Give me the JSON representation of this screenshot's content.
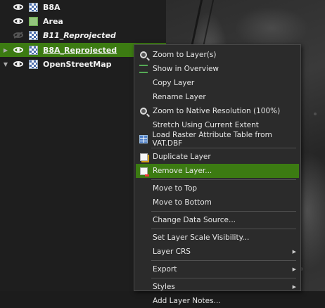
{
  "layers": [
    {
      "name": "B8A",
      "expanded": null,
      "visible": true,
      "type": "raster",
      "italic": false,
      "selected": false
    },
    {
      "name": "Area",
      "expanded": null,
      "visible": true,
      "type": "polygon",
      "italic": false,
      "selected": false
    },
    {
      "name": "B11_Reprojected",
      "expanded": null,
      "visible": false,
      "type": "raster",
      "italic": true,
      "selected": false
    },
    {
      "name": "B8A_Reprojected",
      "expanded": false,
      "visible": true,
      "type": "raster",
      "italic": false,
      "selected": true
    },
    {
      "name": "OpenStreetMap",
      "expanded": true,
      "visible": true,
      "type": "raster",
      "italic": false,
      "selected": false
    }
  ],
  "context_menu": {
    "items": [
      {
        "label": "Zoom to Layer(s)",
        "icon": "zoom-to-layer-icon",
        "has_submenu": false,
        "highlighted": false
      },
      {
        "label": "Show in Overview",
        "icon": "overview-icon",
        "has_submenu": false,
        "highlighted": false
      },
      {
        "label": "Copy Layer",
        "icon": null,
        "has_submenu": false,
        "highlighted": false
      },
      {
        "label": "Rename Layer",
        "icon": null,
        "has_submenu": false,
        "highlighted": false
      },
      {
        "label": "Zoom to Native Resolution (100%)",
        "icon": "zoom-native-icon",
        "has_submenu": false,
        "highlighted": false
      },
      {
        "label": "Stretch Using Current Extent",
        "icon": null,
        "has_submenu": false,
        "highlighted": false
      },
      {
        "label": "Load Raster Attribute Table from VAT.DBF",
        "icon": "table-icon",
        "has_submenu": false,
        "highlighted": false
      },
      {
        "separator": true
      },
      {
        "label": "Duplicate Layer",
        "icon": "duplicate-layer-icon",
        "has_submenu": false,
        "highlighted": false
      },
      {
        "label": "Remove Layer...",
        "icon": "remove-layer-icon",
        "has_submenu": false,
        "highlighted": true
      },
      {
        "separator": true
      },
      {
        "label": "Move to Top",
        "icon": null,
        "has_submenu": false,
        "highlighted": false
      },
      {
        "label": "Move to Bottom",
        "icon": null,
        "has_submenu": false,
        "highlighted": false
      },
      {
        "separator": true
      },
      {
        "label": "Change Data Source...",
        "icon": null,
        "has_submenu": false,
        "highlighted": false
      },
      {
        "separator": true
      },
      {
        "label": "Set Layer Scale Visibility...",
        "icon": null,
        "has_submenu": false,
        "highlighted": false
      },
      {
        "label": "Layer CRS",
        "icon": null,
        "has_submenu": true,
        "highlighted": false
      },
      {
        "separator": true
      },
      {
        "label": "Export",
        "icon": null,
        "has_submenu": true,
        "highlighted": false
      },
      {
        "separator": true
      },
      {
        "label": "Styles",
        "icon": null,
        "has_submenu": true,
        "highlighted": false
      },
      {
        "label": "Add Layer Notes...",
        "icon": null,
        "has_submenu": false,
        "highlighted": false
      }
    ]
  },
  "colors": {
    "selection": "#3c7b12",
    "panel_bg": "#1e1e1e",
    "menu_bg": "#2b2b2b"
  }
}
